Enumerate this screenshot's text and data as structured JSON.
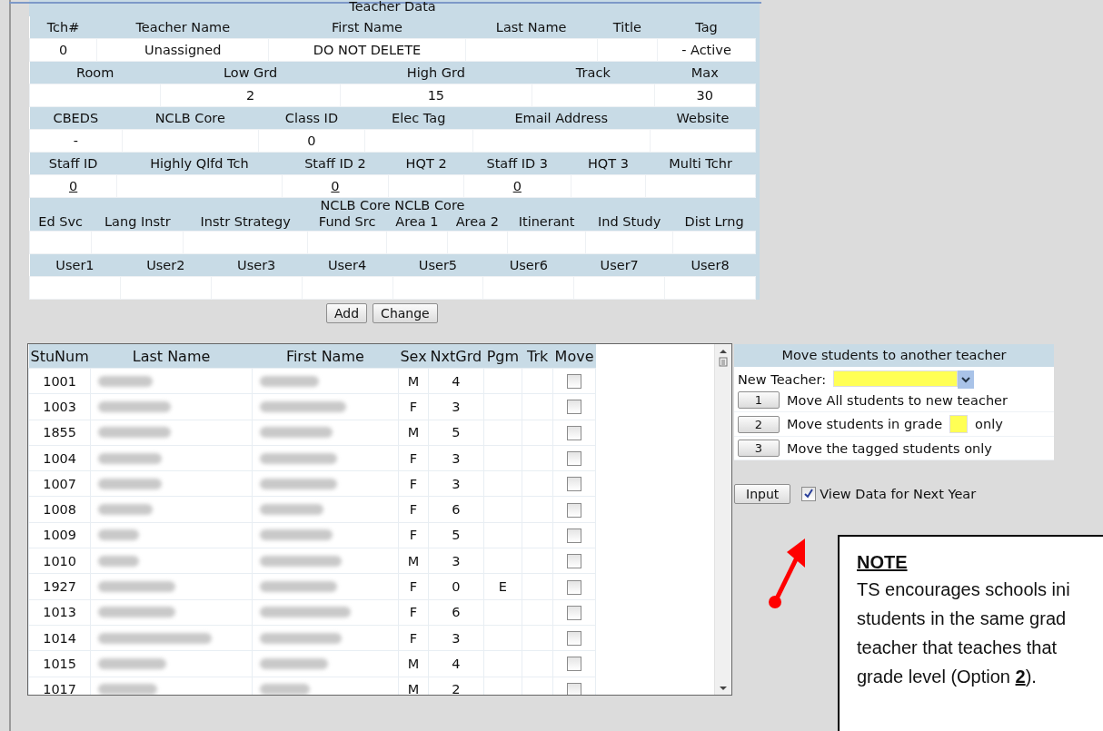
{
  "teacher_data": {
    "title": "Teacher Data",
    "sections": [
      {
        "headers": [
          "Tch#",
          "Teacher Name",
          "First Name",
          "Last Name",
          "Title",
          "Tag"
        ],
        "cells": [
          {
            "text": "0"
          },
          {
            "text": "Unassigned"
          },
          {
            "text": "DO NOT DELETE"
          },
          null,
          null,
          {
            "text": "- Active"
          }
        ]
      },
      {
        "headers": [
          "Room",
          "Low Grd",
          "High Grd",
          "Track",
          "Max"
        ],
        "cells": [
          null,
          {
            "text": "2"
          },
          {
            "text": "15"
          },
          null,
          {
            "text": "30"
          }
        ]
      },
      {
        "headers": [
          "CBEDS",
          "NCLB Core",
          "Class ID",
          "Elec Tag",
          "Email Address",
          "Website"
        ],
        "cells": [
          {
            "text": "-"
          },
          null,
          {
            "text": "0"
          },
          null,
          null,
          null
        ]
      },
      {
        "headers": [
          "Staff ID",
          "Highly Qlfd Tch",
          "Staff ID 2",
          "HQT 2",
          "Staff ID 3",
          "HQT 3",
          "Multi Tchr"
        ],
        "cells": [
          {
            "text": "0",
            "kind": "link"
          },
          null,
          {
            "text": "0",
            "kind": "link"
          },
          null,
          {
            "text": "0",
            "kind": "link"
          },
          null,
          null
        ]
      },
      {
        "caption": "NCLB Core NCLB Core",
        "headers": [
          "Ed Svc",
          "Lang Instr",
          "Instr Strategy",
          "Fund Src",
          "Area 1",
          "Area 2",
          "Itinerant",
          "Ind Study",
          "Dist Lrng"
        ],
        "cells": [
          null,
          null,
          null,
          null,
          null,
          null,
          null,
          null,
          null
        ]
      },
      {
        "headers": [
          "User1",
          "User2",
          "User3",
          "User4",
          "User5",
          "User6",
          "User7",
          "User8"
        ],
        "cells": [
          null,
          null,
          null,
          null,
          null,
          null,
          null,
          null
        ]
      }
    ],
    "buttons": [
      "Add",
      "Change"
    ]
  },
  "students": {
    "columns": [
      "StuNum",
      "Last Name",
      "First Name",
      "Sex",
      "NxtGrd",
      "Pgm",
      "Trk",
      "Move"
    ],
    "rows": [
      {
        "stunum": "1001",
        "sex": "M",
        "nxtgrd": "4",
        "move": false
      },
      {
        "stunum": "1003",
        "sex": "F",
        "nxtgrd": "3",
        "move": false
      },
      {
        "stunum": "1855",
        "sex": "M",
        "nxtgrd": "5",
        "move": false
      },
      {
        "stunum": "1004",
        "sex": "F",
        "nxtgrd": "3",
        "move": false
      },
      {
        "stunum": "1007",
        "sex": "F",
        "nxtgrd": "3",
        "move": false
      },
      {
        "stunum": "1008",
        "sex": "F",
        "nxtgrd": "6",
        "move": false
      },
      {
        "stunum": "1009",
        "sex": "F",
        "nxtgrd": "5",
        "move": false
      },
      {
        "stunum": "1010",
        "sex": "M",
        "nxtgrd": "3",
        "move": false
      },
      {
        "stunum": "1927",
        "sex": "F",
        "nxtgrd": "0",
        "pgm": "E",
        "move": false
      },
      {
        "stunum": "1013",
        "sex": "F",
        "nxtgrd": "6",
        "move": false
      },
      {
        "stunum": "1014",
        "sex": "F",
        "nxtgrd": "3",
        "move": false
      },
      {
        "stunum": "1015",
        "sex": "M",
        "nxtgrd": "4",
        "move": false
      },
      {
        "stunum": "1017",
        "sex": "M",
        "nxtgrd": "2",
        "move": false
      }
    ]
  },
  "move_panel": {
    "title": "Move students to another teacher",
    "new_teacher_label": "New Teacher:",
    "options": [
      {
        "button": "1",
        "label": "Move All students to new teacher",
        "kind": "plain"
      },
      {
        "button": "2",
        "label": "Move students in grade",
        "suffix": "only",
        "kind": "grade"
      },
      {
        "button": "3",
        "label": "Move the tagged students only",
        "kind": "plain"
      }
    ]
  },
  "input_button": "Input",
  "next_year": {
    "label": "View Data for Next Year",
    "checked": true
  },
  "note": {
    "title": "NOTE",
    "lines": [
      "TS encourages schools ini",
      "students in the same grad",
      "teacher that teaches that",
      "grade level (Option **2**)."
    ]
  }
}
